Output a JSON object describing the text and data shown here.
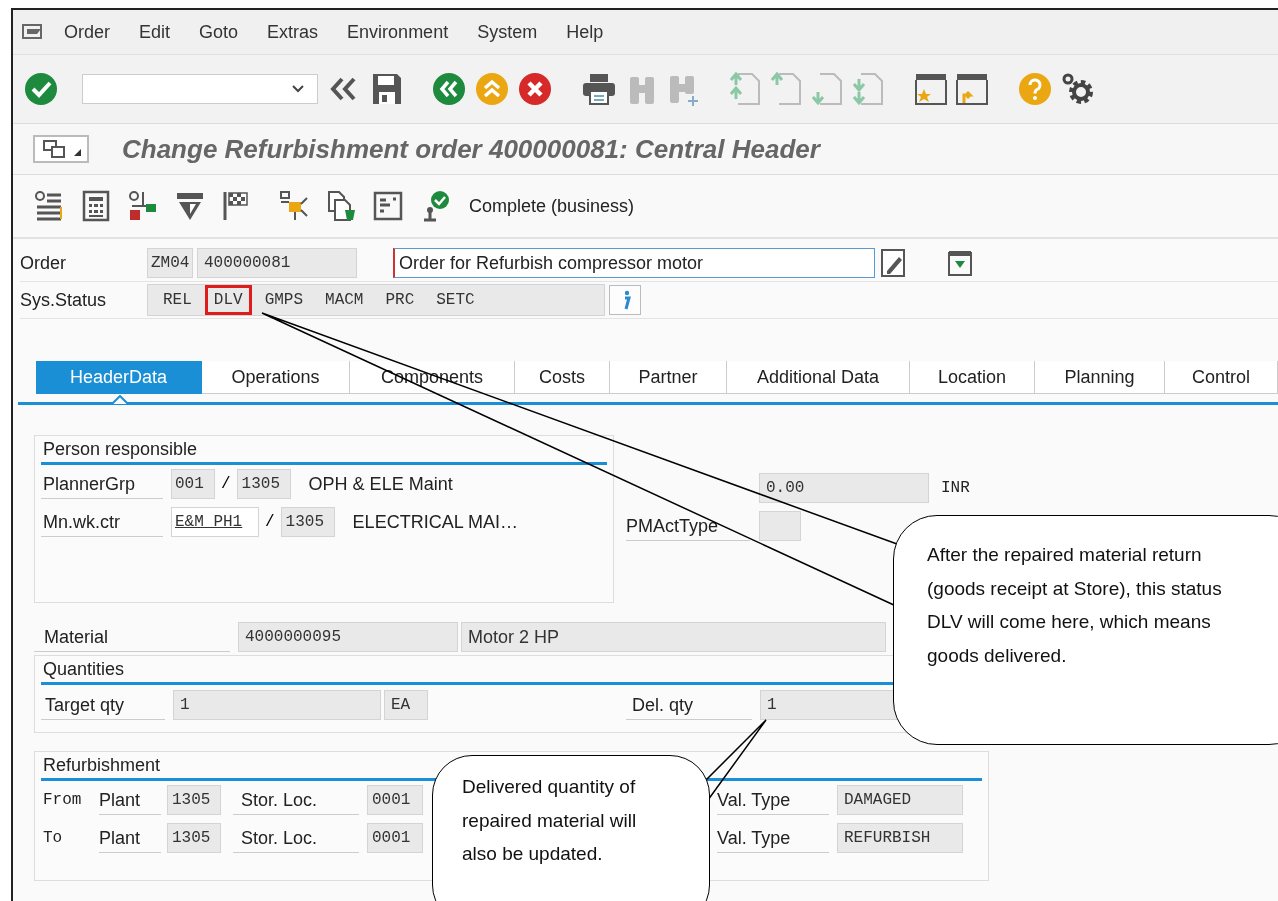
{
  "menu": [
    {
      "label": "Order"
    },
    {
      "label": "Edit"
    },
    {
      "label": "Goto"
    },
    {
      "label": "Extras"
    },
    {
      "label": "Environment"
    },
    {
      "label": "System"
    },
    {
      "label": "Help"
    }
  ],
  "title": "Change Refurbishment order 400000081: Central Header",
  "app_toolbar": {
    "button": "Complete (business)"
  },
  "header": {
    "order_label": "Order",
    "order_type": "ZM04",
    "order_number": "400000081",
    "description": "Order for Refurbish compressor motor",
    "status_label": "Sys.Status",
    "statuses": [
      {
        "code": "REL",
        "highlighted": false
      },
      {
        "code": "DLV",
        "highlighted": true
      },
      {
        "code": "GMPS",
        "highlighted": false
      },
      {
        "code": "MACM",
        "highlighted": false
      },
      {
        "code": "PRC",
        "highlighted": false
      },
      {
        "code": "SETC",
        "highlighted": false
      }
    ]
  },
  "tabs": [
    {
      "label": "HeaderData",
      "selected": true
    },
    {
      "label": "Operations",
      "selected": false
    },
    {
      "label": "Components",
      "selected": false
    },
    {
      "label": "Costs",
      "selected": false
    },
    {
      "label": "Partner",
      "selected": false
    },
    {
      "label": "Additional Data",
      "selected": false
    },
    {
      "label": "Location",
      "selected": false
    },
    {
      "label": "Planning",
      "selected": false
    },
    {
      "label": "Control",
      "selected": false
    }
  ],
  "person_responsible": {
    "title": "Person responsible",
    "rows": [
      {
        "label": "PlannerGrp",
        "code": "001",
        "separator": "/",
        "plant": "1305",
        "text": "OPH & ELE Maint"
      },
      {
        "label": "Mn.wk.ctr",
        "code": "E&M_PH1",
        "separator": "/",
        "plant": "1305",
        "text": "ELECTRICAL MAI…"
      }
    ]
  },
  "costs": {
    "value": "0.00",
    "currency": "INR"
  },
  "activity_type": {
    "label": "PMActType"
  },
  "material": {
    "label": "Material",
    "number": "4000000095",
    "description": "Motor 2 HP"
  },
  "quantities": {
    "title": "Quantities",
    "target_label": "Target qty",
    "target": "1",
    "unit": "EA",
    "delivered_label": "Del. qty",
    "delivered": "1"
  },
  "refurbishment": {
    "title": "Refurbishment",
    "rows": [
      {
        "direction": "From",
        "plant_label": "Plant",
        "plant": "1305",
        "sloc_label": "Stor. Loc.",
        "sloc": "0001",
        "valtype_label": "Val. Type",
        "valtype": "DAMAGED"
      },
      {
        "direction": "To",
        "plant_label": "Plant",
        "plant": "1305",
        "sloc_label": "Stor. Loc.",
        "sloc": "0001",
        "valtype_label": "Val. Type",
        "valtype": "REFURBISH"
      }
    ]
  },
  "callouts": [
    {
      "text": "After the repaired material return (goods receipt at Store), this status DLV will come here, which means goods delivered."
    },
    {
      "text": "Delivered quantity of repaired material will also be updated."
    }
  ]
}
